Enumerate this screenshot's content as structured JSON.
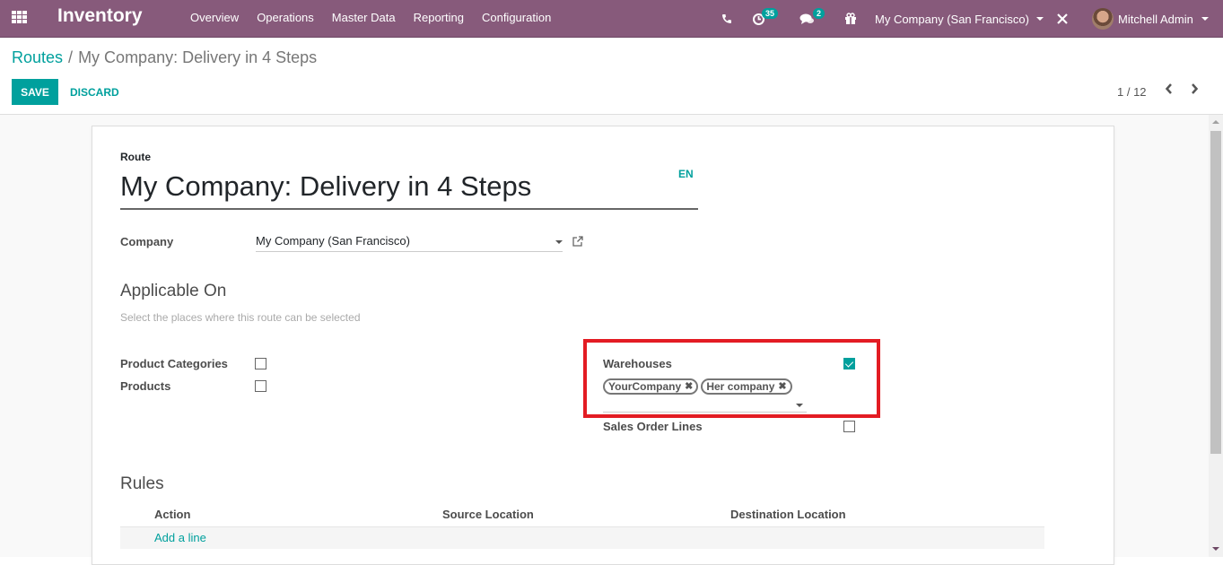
{
  "navbar": {
    "app_title": "Inventory",
    "menu": [
      "Overview",
      "Operations",
      "Master Data",
      "Reporting",
      "Configuration"
    ],
    "activity_count": "35",
    "messages_count": "2",
    "company_switcher": "My Company (San Francisco)",
    "user_name": "Mitchell Admin",
    "colors": {
      "navbar_bg": "#875a7b",
      "accent": "#00a09d"
    }
  },
  "control_panel": {
    "breadcrumb": {
      "parent": "Routes",
      "separator": "/",
      "current": "My Company: Delivery in 4 Steps"
    },
    "save_label": "SAVE",
    "discard_label": "DISCARD",
    "pager": {
      "value": "1 / 12",
      "prev": "‹",
      "next": "›"
    }
  },
  "form": {
    "route_label": "Route",
    "route_name": "My Company: Delivery in 4 Steps",
    "language": "EN",
    "company_label": "Company",
    "company_value": "My Company (San Francisco)",
    "applicable_on": {
      "title": "Applicable On",
      "help": "Select the places where this route can be selected",
      "product_categories": {
        "label": "Product Categories",
        "checked": false
      },
      "products": {
        "label": "Products",
        "checked": false
      },
      "warehouses": {
        "label": "Warehouses",
        "checked": true,
        "tags": [
          "YourCompany",
          "Her company"
        ]
      },
      "sales_order_lines": {
        "label": "Sales Order Lines",
        "checked": false
      }
    },
    "rules": {
      "title": "Rules",
      "columns": [
        "Action",
        "Source Location",
        "Destination Location"
      ],
      "add_line": "Add a line"
    }
  }
}
